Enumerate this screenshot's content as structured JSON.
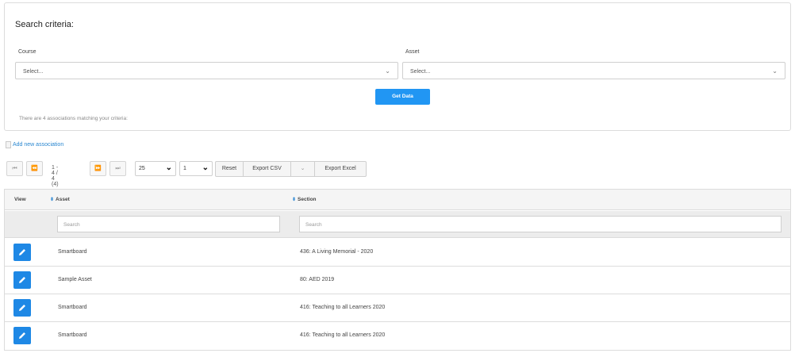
{
  "search": {
    "title": "Search criteria:",
    "course_label": "Course",
    "course_value": "Select...",
    "asset_label": "Asset",
    "asset_value": "Select...",
    "get_data_label": "Get Data",
    "match_text": "There are 4 associations matching your criteria:"
  },
  "add_link": "Add new association",
  "pager": {
    "first": "⏮",
    "prev": "⏪",
    "info": "1 - 4 / 4 (4)",
    "next": "⏩",
    "last": "⏭",
    "page_size": "25",
    "page": "1",
    "reset_label": "Reset",
    "export_csv_label": "Export CSV",
    "dropdown_label": "⌄",
    "export_excel_label": "Export Excel"
  },
  "table": {
    "columns": [
      "View",
      "Asset",
      "Section"
    ],
    "asset_search_placeholder": "Search",
    "section_search_placeholder": "Search",
    "rows": [
      {
        "asset": "Smartboard",
        "section": "436: A Living Memorial - 2020"
      },
      {
        "asset": "Sample Asset",
        "section": "80: AED 2019"
      },
      {
        "asset": "Smartboard",
        "section": "416: Teaching to all Learners 2020"
      },
      {
        "asset": "Smartboard",
        "section": "416: Teaching to all Learners 2020"
      }
    ]
  },
  "colors": {
    "accent": "#2196f3",
    "edit_button": "#1e88e5",
    "link": "#2a87d0"
  }
}
